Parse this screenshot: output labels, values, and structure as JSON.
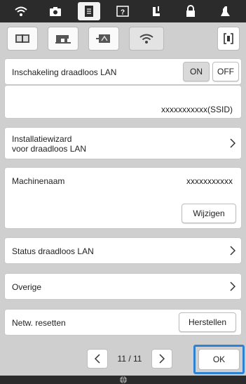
{
  "topbar": {
    "icons": [
      "wifi-signal-icon",
      "camera-icon",
      "document-icon",
      "help-icon",
      "threading-icon",
      "lock-icon",
      "presser-foot-icon"
    ],
    "active_index": 2
  },
  "tabs": [
    "book-icon",
    "sewing-machine-icon",
    "embroidery-icon",
    "wifi-icon"
  ],
  "active_tab": 3,
  "exit_icon": "exit-bracket-icon",
  "wlan_enable": {
    "label": "Inschakeling draadloos LAN",
    "on": "ON",
    "off": "OFF",
    "state": "ON"
  },
  "ssid": {
    "value": "xxxxxxxxxxx(SSID)"
  },
  "wizard": {
    "label_line1": "Installatiewizard",
    "label_line2": "voor draadloos LAN"
  },
  "machine_name": {
    "label": "Machinenaam",
    "value": "xxxxxxxxxxx",
    "change_button": "Wijzigen"
  },
  "wlan_status": {
    "label": "Status draadloos LAN"
  },
  "other": {
    "label": "Overige"
  },
  "network_reset": {
    "label": "Netw. resetten",
    "button": "Herstellen"
  },
  "pager": {
    "text": "11 / 11"
  },
  "ok_button": "OK",
  "bottombar": {
    "icon": "globe-icon"
  }
}
